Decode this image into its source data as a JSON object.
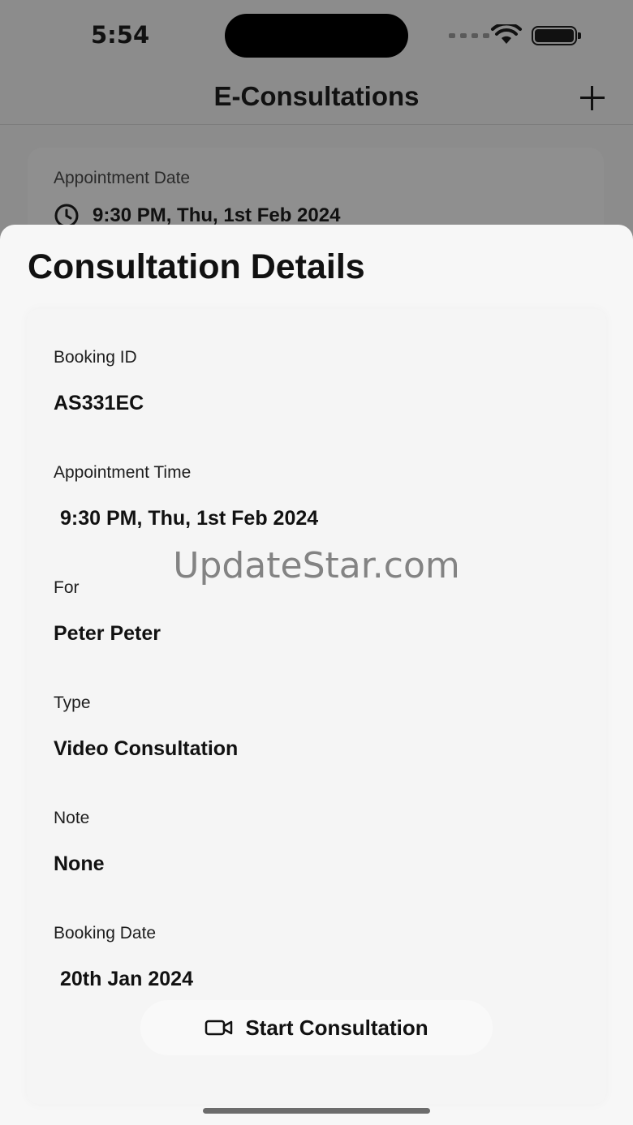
{
  "status_bar": {
    "time": "5:54"
  },
  "nav": {
    "title": "E-Consultations",
    "add_icon": "plus-icon"
  },
  "background_card": {
    "label": "Appointment Date",
    "time": "9:30 PM, Thu, 1st Feb 2024",
    "icon": "clock-icon"
  },
  "sheet": {
    "title": "Consultation Details",
    "fields": [
      {
        "label": "Booking ID",
        "value": "AS331EC"
      },
      {
        "label": "Appointment Time",
        "value": "9:30 PM, Thu, 1st Feb 2024"
      },
      {
        "label": "For",
        "value": "Peter Peter"
      },
      {
        "label": "Type",
        "value": "Video Consultation"
      },
      {
        "label": "Note",
        "value": "None"
      },
      {
        "label": "Booking Date",
        "value": "20th Jan 2024"
      }
    ],
    "start_button": {
      "label": "Start Consultation",
      "icon": "video-camera-icon"
    }
  },
  "watermark": "UpdateStar.com"
}
